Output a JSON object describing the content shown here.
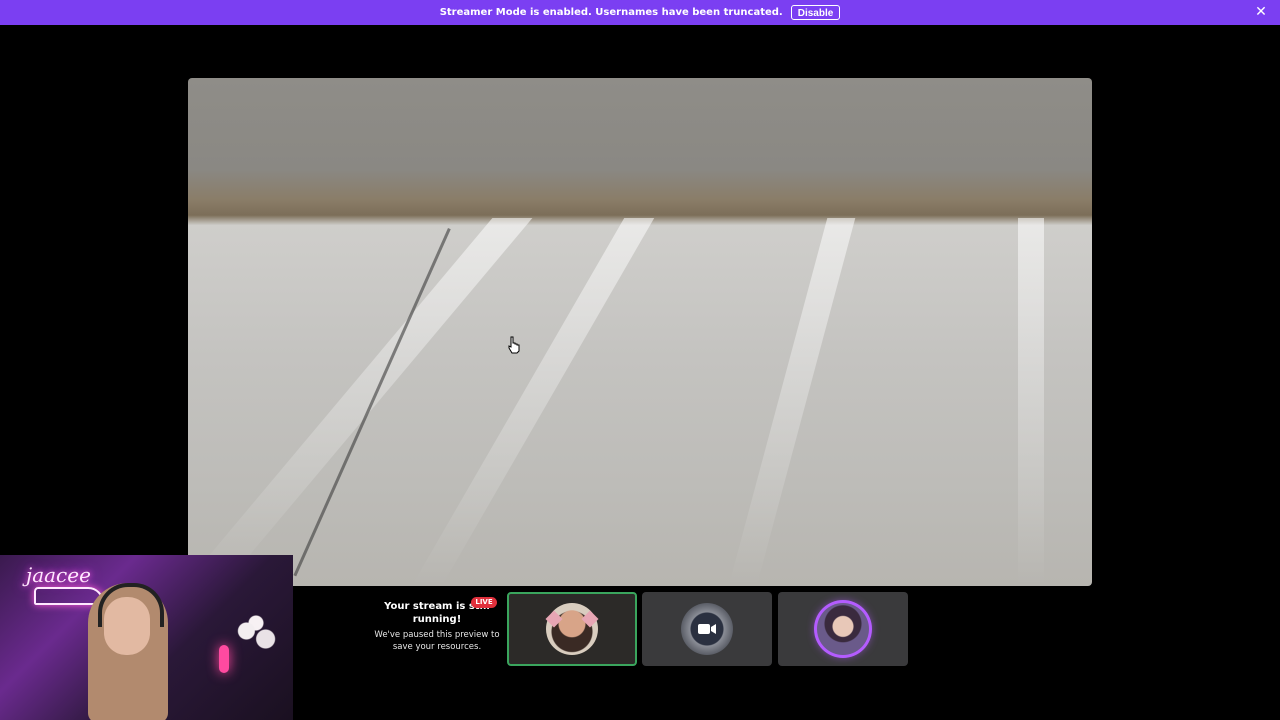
{
  "notice": {
    "message": "Streamer Mode is enabled. Usernames have been truncated.",
    "disable_label": "Disable",
    "close_glyph": "✕"
  },
  "webcam": {
    "neon_sign": "jaacee"
  },
  "paused": {
    "badge": "LIVE",
    "title": "Your stream is still running!",
    "description": "We've paused this preview to save your resources."
  },
  "tiles": [
    {
      "icon": "avatar-man-cat-ears",
      "active": true
    },
    {
      "icon": "video-camera-icon",
      "active": false
    },
    {
      "icon": "avatar-anime",
      "active": false
    }
  ],
  "colors": {
    "accent": "#7b3ff2",
    "live": "#e0303c",
    "active_border": "#3aa55d",
    "glow": "#b45cff"
  }
}
